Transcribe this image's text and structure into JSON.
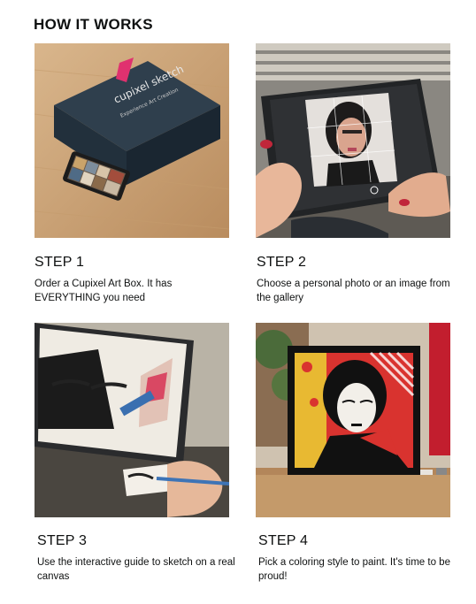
{
  "heading": "HOW IT WORKS",
  "steps": [
    {
      "title": "STEP 1",
      "description": "Order a Cupixel Art Box. It has EVERYTHING you need",
      "box_brand": "cupixel sketch",
      "box_tagline": "Experience Art Creation"
    },
    {
      "title": "STEP 2",
      "description": "Choose a personal photo or an image from the gallery"
    },
    {
      "title": "STEP 3",
      "description": "Use the interactive guide to sketch on a real canvas"
    },
    {
      "title": "STEP 4",
      "description": "Pick a coloring style to paint. It's time to be proud!"
    }
  ]
}
